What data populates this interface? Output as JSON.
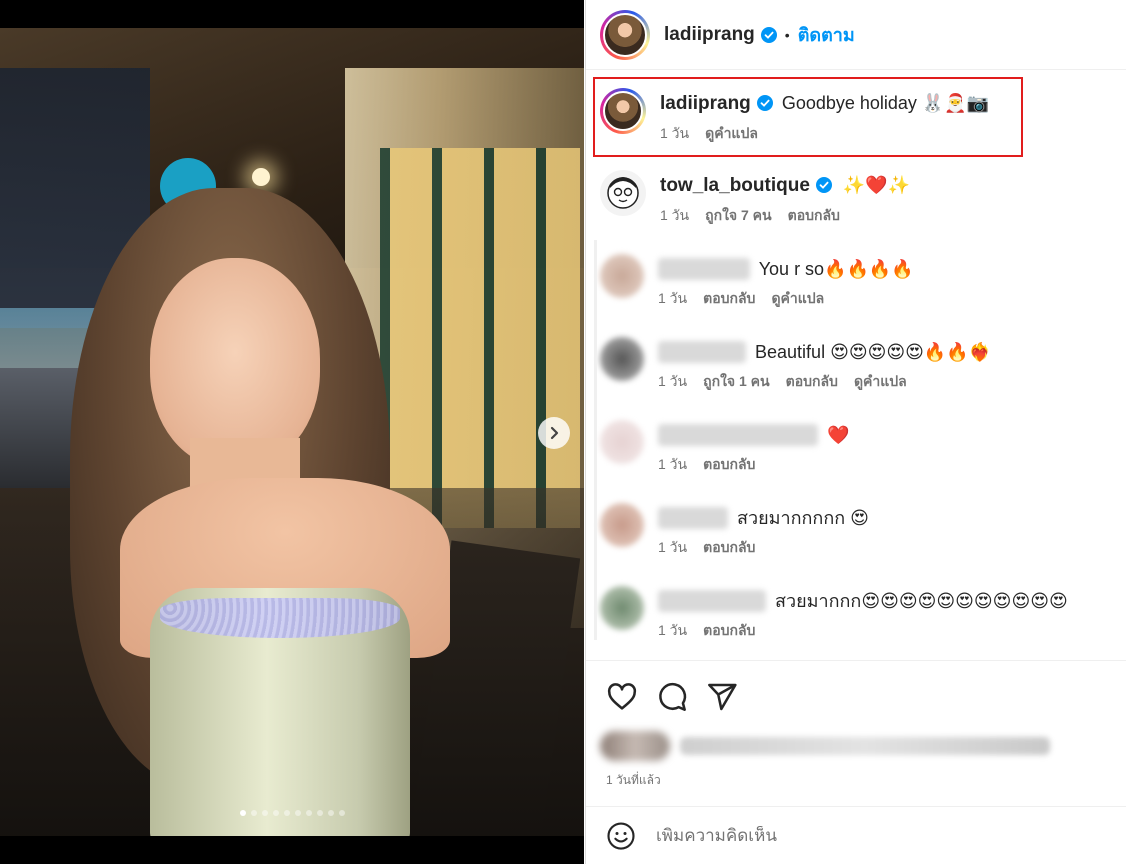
{
  "post": {
    "username": "ladiiprang",
    "follow_label": "ติดตาม",
    "separator": "•"
  },
  "caption": {
    "username": "ladiiprang",
    "text": "Goodbye holiday 🐰🎅📷",
    "time": "1 วัน",
    "translate": "ดูคำแปล"
  },
  "comments": [
    {
      "username": "tow_la_boutique",
      "text": "✨❤️✨",
      "time": "1 วัน",
      "likes": "ถูกใจ 7 คน",
      "reply": "ตอบกลับ"
    },
    {
      "username_hidden": true,
      "text": "You r so🔥🔥🔥🔥",
      "time": "1 วัน",
      "reply": "ตอบกลับ",
      "translate": "ดูคำแปล"
    },
    {
      "username_hidden": true,
      "text": "Beautiful 😍😍😍😍😍🔥🔥❤️‍🔥",
      "time": "1 วัน",
      "likes": "ถูกใจ 1 คน",
      "reply": "ตอบกลับ",
      "translate": "ดูคำแปล"
    },
    {
      "username_hidden": true,
      "text": "❤️",
      "time": "1 วัน",
      "reply": "ตอบกลับ"
    },
    {
      "username_hidden": true,
      "text": "สวยมากกกกก 😍",
      "time": "1 วัน",
      "reply": "ตอบกลับ"
    },
    {
      "username_hidden": true,
      "text": "สวยมากกก😍😍😍😍😍😍😍😍😍😍😍",
      "time": "1 วัน",
      "reply": "ตอบกลับ"
    }
  ],
  "footer": {
    "time_ago": "1 วันที่แล้ว",
    "comment_placeholder": "เพิ่มความคิดเห็น"
  },
  "carousel": {
    "total_slides": 10,
    "current_slide": 1
  },
  "colors": {
    "accent": "#0095f6",
    "highlight": "#e11d1d",
    "verified": "#0095f6"
  }
}
